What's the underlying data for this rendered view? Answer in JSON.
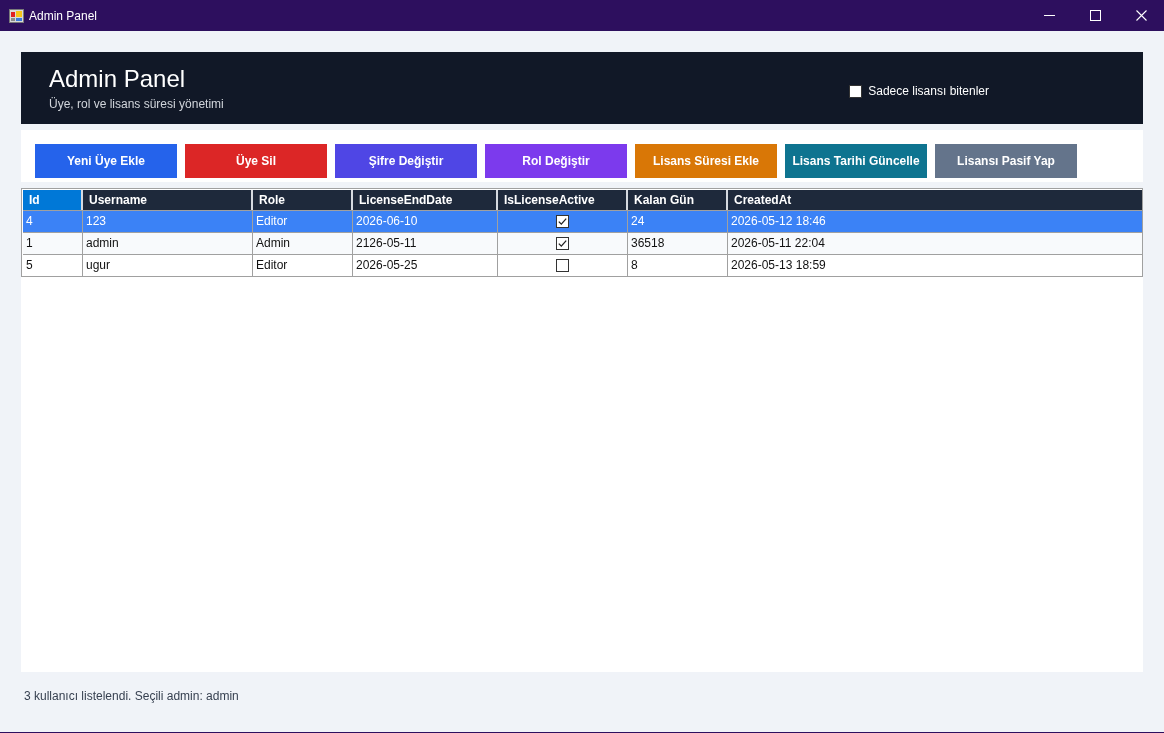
{
  "window": {
    "title": "Admin Panel"
  },
  "header": {
    "title": "Admin Panel",
    "subtitle": "Üye, rol ve lisans süresi yönetimi",
    "filter": {
      "label": "Sadece lisansı bitenler",
      "checked": false
    }
  },
  "toolbar": {
    "buttons": [
      {
        "label": "Yeni Üye Ekle",
        "color": "#2563eb"
      },
      {
        "label": "Üye Sil",
        "color": "#dc2626"
      },
      {
        "label": "Şifre Değiştir",
        "color": "#4f46e5"
      },
      {
        "label": "Rol Değiştir",
        "color": "#7c3aed"
      },
      {
        "label": "Lisans Süresi Ekle",
        "color": "#d97706"
      },
      {
        "label": "Lisans Tarihi Güncelle",
        "color": "#0e7490"
      },
      {
        "label": "Lisansı Pasif Yap",
        "color": "#64748b"
      }
    ]
  },
  "table": {
    "columns": [
      {
        "label": "Id",
        "kind": "text",
        "selected": true
      },
      {
        "label": "Username",
        "kind": "text",
        "selected": false
      },
      {
        "label": "Role",
        "kind": "text",
        "selected": false
      },
      {
        "label": "LicenseEndDate",
        "kind": "text",
        "selected": false
      },
      {
        "label": "IsLicenseActive",
        "kind": "checkbox",
        "selected": false
      },
      {
        "label": "Kalan Gün",
        "kind": "text",
        "selected": false
      },
      {
        "label": "CreatedAt",
        "kind": "text",
        "selected": false
      }
    ],
    "rows": [
      {
        "selected": true,
        "cells": [
          "4",
          "123",
          "Editor",
          "2026-06-10",
          true,
          "24",
          "2026-05-12 18:46"
        ]
      },
      {
        "selected": false,
        "cells": [
          "1",
          "admin",
          "Admin",
          "2126-05-11",
          true,
          "36518",
          "2026-05-11 22:04"
        ]
      },
      {
        "selected": false,
        "cells": [
          "5",
          "ugur",
          "Editor",
          "2026-05-25",
          false,
          "8",
          "2026-05-13 18:59"
        ]
      }
    ]
  },
  "status_bar": {
    "text": "3 kullanıcı listelendi. Seçili admin: admin"
  }
}
